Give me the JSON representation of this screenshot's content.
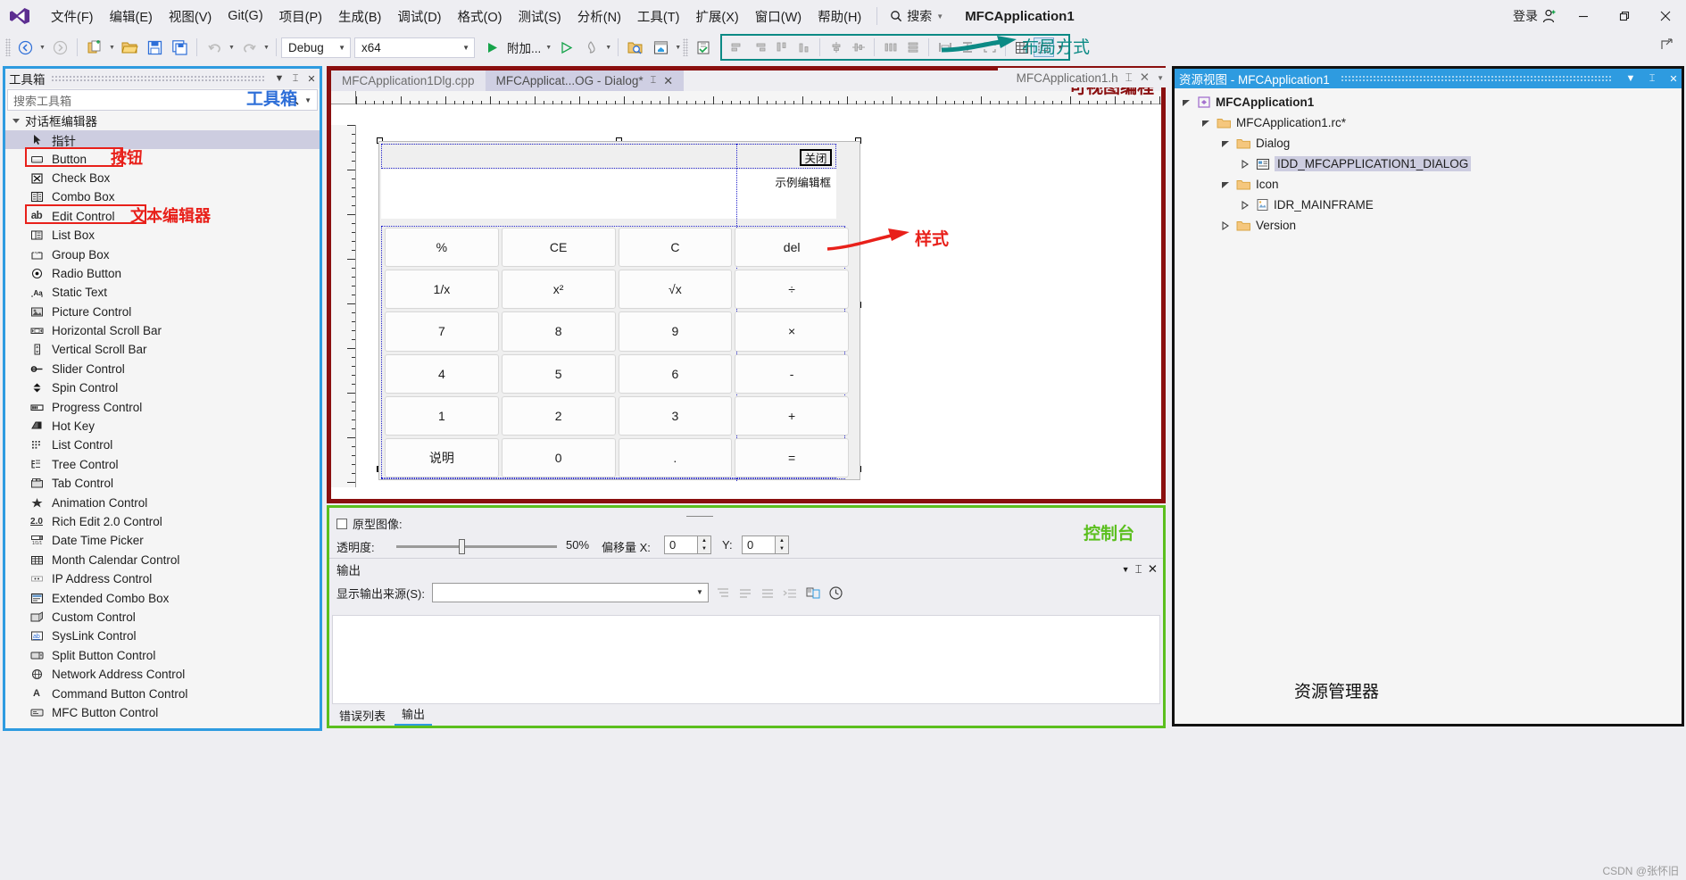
{
  "window": {
    "title": "MFCApplication1",
    "signin_label": "登录"
  },
  "menubar": {
    "items": [
      {
        "label": "文件(F)"
      },
      {
        "label": "编辑(E)"
      },
      {
        "label": "视图(V)"
      },
      {
        "label": "Git(G)"
      },
      {
        "label": "项目(P)"
      },
      {
        "label": "生成(B)"
      },
      {
        "label": "调试(D)"
      },
      {
        "label": "格式(O)"
      },
      {
        "label": "测试(S)"
      },
      {
        "label": "分析(N)"
      },
      {
        "label": "工具(T)"
      },
      {
        "label": "扩展(X)"
      },
      {
        "label": "窗口(W)"
      },
      {
        "label": "帮助(H)"
      }
    ],
    "search_placeholder": "搜索"
  },
  "toolbar": {
    "configuration": "Debug",
    "platform": "x64",
    "attach_label": "附加...",
    "layout_annotation": "布局方式"
  },
  "toolbox": {
    "title": "工具箱",
    "search_placeholder": "搜索工具箱",
    "annotation": "工具箱",
    "group_label": "对话框编辑器",
    "items": [
      {
        "label": "指针",
        "icon": "pointer-icon",
        "selected": true
      },
      {
        "label": "Button",
        "icon": "button-icon",
        "selected": false
      },
      {
        "label": "Check Box",
        "icon": "checkbox-icon",
        "selected": false
      },
      {
        "label": "Combo Box",
        "icon": "combobox-icon",
        "selected": false
      },
      {
        "label": "Edit Control",
        "icon": "edit-control-icon",
        "selected": false
      },
      {
        "label": "List Box",
        "icon": "listbox-icon",
        "selected": false
      },
      {
        "label": "Group Box",
        "icon": "groupbox-icon",
        "selected": false
      },
      {
        "label": "Radio Button",
        "icon": "radio-icon",
        "selected": false
      },
      {
        "label": "Static Text",
        "icon": "static-text-icon",
        "selected": false
      },
      {
        "label": "Picture Control",
        "icon": "picture-icon",
        "selected": false
      },
      {
        "label": "Horizontal Scroll Bar",
        "icon": "hscroll-icon",
        "selected": false
      },
      {
        "label": "Vertical Scroll Bar",
        "icon": "vscroll-icon",
        "selected": false
      },
      {
        "label": "Slider Control",
        "icon": "slider-icon",
        "selected": false
      },
      {
        "label": "Spin Control",
        "icon": "spin-icon",
        "selected": false
      },
      {
        "label": "Progress Control",
        "icon": "progress-icon",
        "selected": false
      },
      {
        "label": "Hot Key",
        "icon": "hotkey-icon",
        "selected": false
      },
      {
        "label": "List Control",
        "icon": "list-control-icon",
        "selected": false
      },
      {
        "label": "Tree Control",
        "icon": "tree-control-icon",
        "selected": false
      },
      {
        "label": "Tab Control",
        "icon": "tab-control-icon",
        "selected": false
      },
      {
        "label": "Animation Control",
        "icon": "animation-icon",
        "selected": false
      },
      {
        "label": "Rich Edit 2.0 Control",
        "icon": "rich-edit-icon",
        "selected": false
      },
      {
        "label": "Date Time Picker",
        "icon": "datetime-icon",
        "selected": false
      },
      {
        "label": "Month Calendar Control",
        "icon": "calendar-icon",
        "selected": false
      },
      {
        "label": "IP Address Control",
        "icon": "ip-address-icon",
        "selected": false
      },
      {
        "label": "Extended Combo Box",
        "icon": "ext-combobox-icon",
        "selected": false
      },
      {
        "label": "Custom Control",
        "icon": "custom-control-icon",
        "selected": false
      },
      {
        "label": "SysLink Control",
        "icon": "syslink-icon",
        "selected": false
      },
      {
        "label": "Split Button Control",
        "icon": "split-button-icon",
        "selected": false
      },
      {
        "label": "Network Address Control",
        "icon": "network-address-icon",
        "selected": false
      },
      {
        "label": "Command Button Control",
        "icon": "command-button-icon",
        "selected": false
      },
      {
        "label": "MFC Button Control",
        "icon": "mfc-button-icon",
        "selected": false
      }
    ],
    "annotation_button": "按钮",
    "annotation_edit": "文本编辑器"
  },
  "editor": {
    "tabs": [
      {
        "label": "MFCApplication1Dlg.cpp",
        "active": false
      },
      {
        "label": "MFCApplicat...OG - Dialog*",
        "active": true
      }
    ],
    "right_tab_label": "MFCApplication1.h",
    "annotation": "可视图编程",
    "dialog": {
      "close_button": "关闭",
      "sample_text": "示例编辑框",
      "buttons": [
        "%",
        "CE",
        "C",
        "del",
        "1/x",
        "x²",
        "√x",
        "÷",
        "7",
        "8",
        "9",
        "×",
        "4",
        "5",
        "6",
        "-",
        "1",
        "2",
        "3",
        "+",
        "说明",
        "0",
        ".",
        "="
      ]
    },
    "style_annotation": "样式"
  },
  "resource_view": {
    "title": "资源视图 - MFCApplication1",
    "annotation": "资源管理器",
    "tree": [
      {
        "label": "MFCApplication1",
        "depth": 0,
        "icon": "project-icon",
        "expanded": true,
        "selected": false,
        "bold": true
      },
      {
        "label": "MFCApplication1.rc*",
        "depth": 1,
        "icon": "folder-icon",
        "expanded": true,
        "selected": false,
        "bold": false
      },
      {
        "label": "Dialog",
        "depth": 2,
        "icon": "folder-icon",
        "expanded": true,
        "selected": false,
        "bold": false
      },
      {
        "label": "IDD_MFCAPPLICATION1_DIALOG",
        "depth": 3,
        "icon": "dialog-icon",
        "expanded": false,
        "selected": true,
        "bold": false
      },
      {
        "label": "Icon",
        "depth": 2,
        "icon": "folder-icon",
        "expanded": true,
        "selected": false,
        "bold": false
      },
      {
        "label": "IDR_MAINFRAME",
        "depth": 3,
        "icon": "icon-file-icon",
        "expanded": false,
        "selected": false,
        "bold": false
      },
      {
        "label": "Version",
        "depth": 2,
        "icon": "folder-icon",
        "expanded": false,
        "selected": false,
        "bold": false
      }
    ]
  },
  "bottom_panel": {
    "annotation": "控制台",
    "prototype_label": "原型图像:",
    "transparency_label": "透明度:",
    "transparency_value": "50%",
    "offset_label": "偏移量 X:",
    "offset_x": "0",
    "offset_y_label": "Y:",
    "offset_y": "0",
    "output_title": "输出",
    "output_source_label": "显示输出来源(S):",
    "output_source_value": "",
    "tabs": [
      {
        "label": "错误列表",
        "active": false
      },
      {
        "label": "输出",
        "active": true
      }
    ]
  },
  "watermark": "CSDN @张怀旧"
}
